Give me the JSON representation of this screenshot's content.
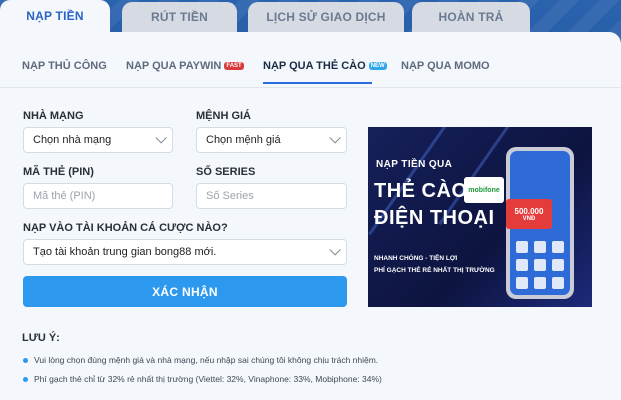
{
  "top_tabs": [
    {
      "label": "NẠP TIỀN",
      "active": true
    },
    {
      "label": "RÚT TIỀN",
      "active": false
    },
    {
      "label": "LỊCH SỬ GIAO DỊCH",
      "active": false
    },
    {
      "label": "HOÀN TRẢ",
      "active": false
    }
  ],
  "method_tabs": [
    {
      "label": "NẠP THỦ CÔNG"
    },
    {
      "label": "NẠP QUA PAYWIN",
      "badge": "FAST"
    },
    {
      "label": "NẠP QUA THẺ CÀO",
      "badge": "NEW",
      "active": true
    },
    {
      "label": "NẠP QUA MOMO"
    }
  ],
  "form": {
    "carrier_label": "NHÀ MẠNG",
    "carrier_value": "Chọn nhà mạng",
    "denomination_label": "MỆNH GIÁ",
    "denomination_value": "Chọn mệnh giá",
    "pin_label": "MÃ THẺ (PIN)",
    "pin_placeholder": "Mã thẻ (PIN)",
    "serial_label": "SỐ SERIES",
    "serial_placeholder": "Số Series",
    "account_label": "NẠP VÀO TÀI KHOẢN CÁ CƯỢC NÀO?",
    "account_value": "Tạo tài khoản trung gian bong88 mới.",
    "confirm_label": "XÁC NHẬN"
  },
  "banner": {
    "line1": "NẠP TIỀN QUA",
    "line2": "THẺ CÀO",
    "line3": "ĐIỆN THOẠI",
    "line4": "NHANH CHÓNG - TIỆN LỢI",
    "line5": "PHÍ GẠCH THẺ RẺ NHẤT THỊ TRƯỜNG",
    "card_brand": "mobifone",
    "card_value": "500.000",
    "card_unit": "VNĐ"
  },
  "notes": {
    "title": "LƯU Ý:",
    "items": [
      "Vui lòng chọn đúng mệnh giá và nhà mạng, nếu nhập sai chúng tôi không chịu trách nhiệm.",
      "Phí gạch thẻ chỉ từ 32% rẻ nhất thị trường (Viettel: 32%, Vinaphone: 33%, Mobiphone: 34%)"
    ]
  },
  "colors": {
    "accent": "#2c99ee",
    "active_tab_text": "#2a64c4",
    "fast_badge": "#d93a3a",
    "new_badge": "#2ea6e8"
  }
}
